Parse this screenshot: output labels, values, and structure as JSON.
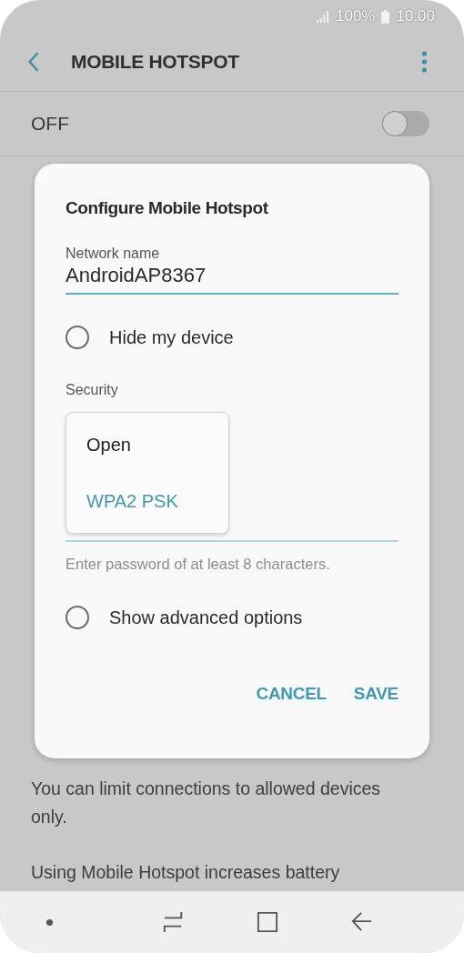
{
  "status_bar": {
    "battery": "100%",
    "time": "10:00"
  },
  "header": {
    "title": "MOBILE HOTSPOT"
  },
  "master_switch": {
    "label": "OFF",
    "on": false
  },
  "background_text": [
    "You can limit connections to allowed devices only.",
    "Using Mobile Hotspot increases battery"
  ],
  "dialog": {
    "title": "Configure Mobile Hotspot",
    "network_name": {
      "label": "Network name",
      "value": "AndroidAP8367"
    },
    "hide_device": {
      "label": "Hide my device",
      "checked": false
    },
    "security": {
      "label": "Security",
      "options": [
        {
          "label": "Open",
          "selected": false
        },
        {
          "label": "WPA2 PSK",
          "selected": true
        }
      ]
    },
    "password_hint": "Enter password of at least 8 characters.",
    "advanced": {
      "label": "Show advanced options",
      "checked": false
    },
    "buttons": [
      {
        "label": "CANCEL"
      },
      {
        "label": "SAVE"
      }
    ]
  }
}
